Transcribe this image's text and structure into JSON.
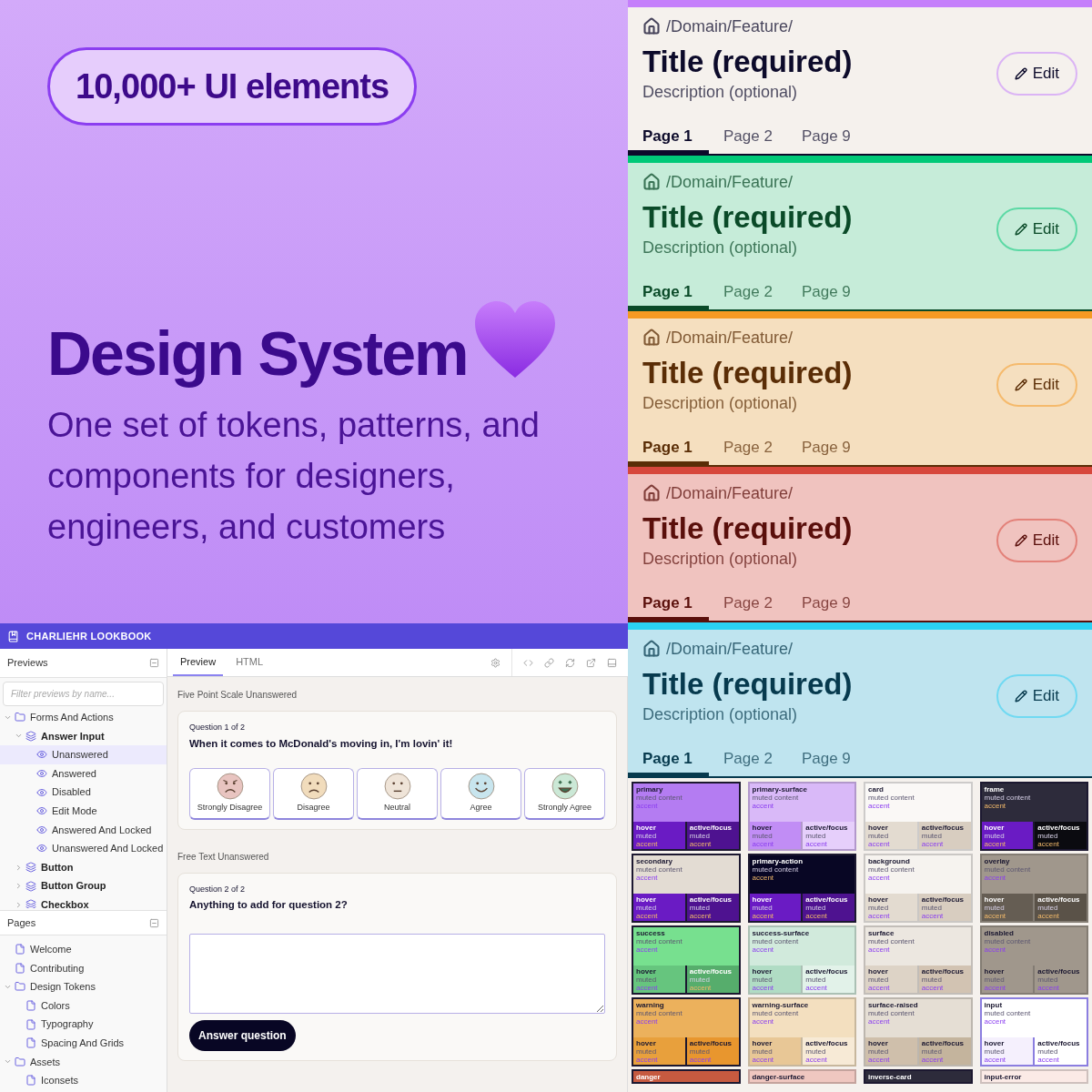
{
  "hero": {
    "badge": "10,000+ UI elements",
    "title": "Design System",
    "subtitle": "One set of tokens, patterns, and components for designers, engineers, and customers"
  },
  "lookbook": {
    "app_title": "CHARLIEHR LOOKBOOK",
    "previews": {
      "title": "Previews",
      "filter_placeholder": "Filter previews by name...",
      "tree": [
        {
          "label": "Forms And Actions",
          "kind": "folder",
          "expanded": true,
          "selected": false,
          "children": [
            {
              "label": "Answer Input",
              "kind": "component",
              "expanded": true,
              "selected": false,
              "children": [
                {
                  "label": "Unanswered",
                  "kind": "preview",
                  "selected": true
                },
                {
                  "label": "Answered",
                  "kind": "preview",
                  "selected": false
                },
                {
                  "label": "Disabled",
                  "kind": "preview",
                  "selected": false
                },
                {
                  "label": "Edit Mode",
                  "kind": "preview",
                  "selected": false
                },
                {
                  "label": "Answered And Locked",
                  "kind": "preview",
                  "selected": false
                },
                {
                  "label": "Unanswered And Locked",
                  "kind": "preview",
                  "selected": false
                }
              ]
            },
            {
              "label": "Button",
              "kind": "component",
              "expanded": false,
              "selected": false
            },
            {
              "label": "Button Group",
              "kind": "component",
              "expanded": false,
              "selected": false
            },
            {
              "label": "Checkbox",
              "kind": "component",
              "expanded": false,
              "selected": false
            }
          ]
        }
      ]
    },
    "pages": {
      "title": "Pages",
      "tree": [
        {
          "label": "Welcome",
          "kind": "page",
          "selected": false
        },
        {
          "label": "Contributing",
          "kind": "page",
          "selected": false
        },
        {
          "label": "Design Tokens",
          "kind": "folder",
          "expanded": true,
          "selected": false,
          "children": [
            {
              "label": "Colors",
              "kind": "page",
              "selected": false
            },
            {
              "label": "Typography",
              "kind": "page",
              "selected": false
            },
            {
              "label": "Spacing And Grids",
              "kind": "page",
              "selected": false
            }
          ]
        },
        {
          "label": "Assets",
          "kind": "folder",
          "expanded": true,
          "selected": false,
          "children": [
            {
              "label": "Iconsets",
              "kind": "page",
              "selected": false
            }
          ]
        }
      ]
    },
    "tabs": [
      {
        "label": "Preview",
        "selected": true
      },
      {
        "label": "HTML",
        "selected": false
      }
    ],
    "sections": [
      {
        "kind": "scale",
        "heading": "Five Point Scale Unanswered",
        "question_number": "Question 1 of 2",
        "question": "When it comes to McDonald's moving in, I'm lovin' it!",
        "options": [
          {
            "label": "Strongly Disagree",
            "color": "#e8c4c0"
          },
          {
            "label": "Disagree",
            "color": "#f1dcbc"
          },
          {
            "label": "Neutral",
            "color": "#efe4d8"
          },
          {
            "label": "Agree",
            "color": "#c8e5ee"
          },
          {
            "label": "Strongly Agree",
            "color": "#cbe8d6"
          }
        ]
      },
      {
        "kind": "text",
        "heading": "Free Text Unanswered",
        "question_number": "Question 2 of 2",
        "question": "Anything to add for question 2?",
        "button": "Answer question"
      }
    ]
  },
  "headers": [
    {
      "kind": "neutral",
      "breadcrumb": "/Domain/Feature/",
      "title": "Title (required)",
      "description": "Description (optional)",
      "edit": "Edit",
      "color": "#c57ffb",
      "tabs": [
        {
          "label": "Page 1",
          "selected": true
        },
        {
          "label": "Page 2",
          "selected": false
        },
        {
          "label": "Page 9",
          "selected": false
        }
      ]
    },
    {
      "kind": "success",
      "breadcrumb": "/Domain/Feature/",
      "title": "Title (required)",
      "description": "Description (optional)",
      "edit": "Edit",
      "color": "#00c978",
      "tabs": [
        {
          "label": "Page 1",
          "selected": true
        },
        {
          "label": "Page 2",
          "selected": false
        },
        {
          "label": "Page 9",
          "selected": false
        }
      ]
    },
    {
      "kind": "warning",
      "breadcrumb": "/Domain/Feature/",
      "title": "Title (required)",
      "description": "Description (optional)",
      "edit": "Edit",
      "color": "#f59a23",
      "tabs": [
        {
          "label": "Page 1",
          "selected": true
        },
        {
          "label": "Page 2",
          "selected": false
        },
        {
          "label": "Page 9",
          "selected": false
        }
      ]
    },
    {
      "kind": "danger",
      "breadcrumb": "/Domain/Feature/",
      "title": "Title (required)",
      "description": "Description (optional)",
      "edit": "Edit",
      "color": "#d7473c",
      "tabs": [
        {
          "label": "Page 1",
          "selected": true
        },
        {
          "label": "Page 2",
          "selected": false
        },
        {
          "label": "Page 9",
          "selected": false
        }
      ]
    },
    {
      "kind": "info",
      "breadcrumb": "/Domain/Feature/",
      "title": "Title (required)",
      "description": "Description (optional)",
      "edit": "Edit",
      "color": "#2bd1f3",
      "tabs": [
        {
          "label": "Page 1",
          "selected": true
        },
        {
          "label": "Page 2",
          "selected": false
        },
        {
          "label": "Page 9",
          "selected": false
        }
      ]
    }
  ],
  "swatches": [
    {
      "kind": "solid",
      "name": "primary",
      "muted": "muted content",
      "accent": "accent",
      "color": "#b47cf2",
      "hover": {
        "label": "hover",
        "muted": "muted",
        "accent": "accent",
        "color": "#6a1bc4"
      },
      "active": {
        "label": "active/focus",
        "muted": "muted",
        "accent": "accent",
        "color": "#4e1290"
      }
    },
    {
      "kind": "surface",
      "name": "primary-surface",
      "muted": "muted content",
      "accent": "accent",
      "color": "#d9b9f8",
      "hover": {
        "label": "hover",
        "muted": "muted",
        "accent": "accent",
        "color": "#c18df5"
      },
      "active": {
        "label": "active/focus",
        "muted": "muted",
        "accent": "accent",
        "color": "#e6cffb"
      }
    },
    {
      "kind": "surface",
      "name": "card",
      "muted": "muted content",
      "accent": "accent",
      "color": "#faf8f6",
      "hover": {
        "label": "hover",
        "muted": "muted",
        "accent": "accent",
        "color": "#e3dbd0"
      },
      "active": {
        "label": "active/focus",
        "muted": "muted",
        "accent": "accent",
        "color": "#d8cdc0"
      }
    },
    {
      "kind": "solid",
      "name": "frame",
      "muted": "muted content",
      "accent": "accent",
      "color": "#2d2b3b",
      "hover": {
        "label": "hover",
        "muted": "muted",
        "accent": "accent",
        "color": "#6a1bc4"
      },
      "active": {
        "label": "active/focus",
        "muted": "muted",
        "accent": "accent",
        "color": "#0b0b10"
      }
    },
    {
      "kind": "solid",
      "name": "secondary",
      "muted": "muted content",
      "accent": "accent",
      "color": "#e3dcd3",
      "hover": {
        "label": "hover",
        "muted": "muted",
        "accent": "accent",
        "color": "#6a1bc4"
      },
      "active": {
        "label": "active/focus",
        "muted": "muted",
        "accent": "accent",
        "color": "#4e1290"
      }
    },
    {
      "kind": "solid",
      "name": "primary-action",
      "muted": "muted content",
      "accent": "accent",
      "color": "#080624",
      "hover": {
        "label": "hover",
        "muted": "muted",
        "accent": "accent",
        "color": "#6a1bc4"
      },
      "active": {
        "label": "active/focus",
        "muted": "muted",
        "accent": "accent",
        "color": "#4e1290"
      }
    },
    {
      "kind": "surface",
      "name": "background",
      "muted": "muted content",
      "accent": "accent",
      "color": "#f6f3ef",
      "hover": {
        "label": "hover",
        "muted": "muted",
        "accent": "accent",
        "color": "#e3dbd0"
      },
      "active": {
        "label": "active/focus",
        "muted": "muted",
        "accent": "accent",
        "color": "#d8cdc0"
      }
    },
    {
      "kind": "surface",
      "name": "overlay",
      "muted": "muted content",
      "accent": "accent",
      "color": "#a0978c",
      "hover": {
        "label": "hover",
        "muted": "muted",
        "accent": "accent",
        "color": "#655d53"
      },
      "active": {
        "label": "active/focus",
        "muted": "muted",
        "accent": "accent",
        "color": "#5a5248"
      }
    },
    {
      "kind": "solid",
      "name": "success",
      "muted": "muted content",
      "accent": "accent",
      "color": "#77e08f",
      "hover": {
        "label": "hover",
        "muted": "muted",
        "accent": "accent",
        "color": "#66c57e"
      },
      "active": {
        "label": "active/focus",
        "muted": "muted",
        "accent": "accent",
        "color": "#56ad6c"
      }
    },
    {
      "kind": "surface",
      "name": "success-surface",
      "muted": "muted content",
      "accent": "accent",
      "color": "#d1eadc",
      "hover": {
        "label": "hover",
        "muted": "muted",
        "accent": "accent",
        "color": "#b0dcc4"
      },
      "active": {
        "label": "active/focus",
        "muted": "muted",
        "accent": "accent",
        "color": "#e2f2e9"
      }
    },
    {
      "kind": "surface",
      "name": "surface",
      "muted": "muted content",
      "accent": "accent",
      "color": "#ece7e0",
      "hover": {
        "label": "hover",
        "muted": "muted",
        "accent": "accent",
        "color": "#ddd3c6"
      },
      "active": {
        "label": "active/focus",
        "muted": "muted",
        "accent": "accent",
        "color": "#d2c3b2"
      }
    },
    {
      "kind": "surface",
      "name": "disabled",
      "muted": "muted content",
      "accent": "accent",
      "color": "#a0978c",
      "hover": {
        "label": "hover",
        "muted": "muted",
        "accent": "accent",
        "color": "#a0978c"
      },
      "active": {
        "label": "active/focus",
        "muted": "muted",
        "accent": "accent",
        "color": "#a0978c"
      }
    },
    {
      "kind": "solid",
      "name": "warning",
      "muted": "muted content",
      "accent": "accent",
      "color": "#ecb15c",
      "hover": {
        "label": "hover",
        "muted": "muted",
        "accent": "accent",
        "color": "#e8a03c"
      },
      "active": {
        "label": "active/focus",
        "muted": "muted",
        "accent": "accent",
        "color": "#e8962e"
      }
    },
    {
      "kind": "surface",
      "name": "warning-surface",
      "muted": "muted content",
      "accent": "accent",
      "color": "#f3dfbf",
      "hover": {
        "label": "hover",
        "muted": "muted",
        "accent": "accent",
        "color": "#e8c796"
      },
      "active": {
        "label": "active/focus",
        "muted": "muted",
        "accent": "accent",
        "color": "#f7ead6"
      }
    },
    {
      "kind": "surface",
      "name": "surface-raised",
      "muted": "muted content",
      "accent": "accent",
      "color": "#e5ded4",
      "hover": {
        "label": "hover",
        "muted": "muted",
        "accent": "accent",
        "color": "#cfbfab"
      },
      "active": {
        "label": "active/focus",
        "muted": "muted",
        "accent": "accent",
        "color": "#c4b49d"
      }
    },
    {
      "kind": "input",
      "name": "input",
      "muted": "muted content",
      "accent": "accent",
      "color": "#ffffff",
      "hover": {
        "label": "hover",
        "muted": "muted",
        "accent": "accent",
        "color": "#f5f0fd"
      },
      "active": {
        "label": "active/focus",
        "muted": "muted",
        "accent": "accent",
        "color": "#ffffff"
      }
    },
    {
      "kind": "solid",
      "name": "danger",
      "color": "#c65a40"
    },
    {
      "kind": "surface",
      "name": "danger-surface",
      "color": "#efc7c0"
    },
    {
      "kind": "solid",
      "name": "inverse-card",
      "color": "#2d2b3b"
    },
    {
      "kind": "surface",
      "name": "input-error",
      "color": "#fbeae6"
    }
  ]
}
